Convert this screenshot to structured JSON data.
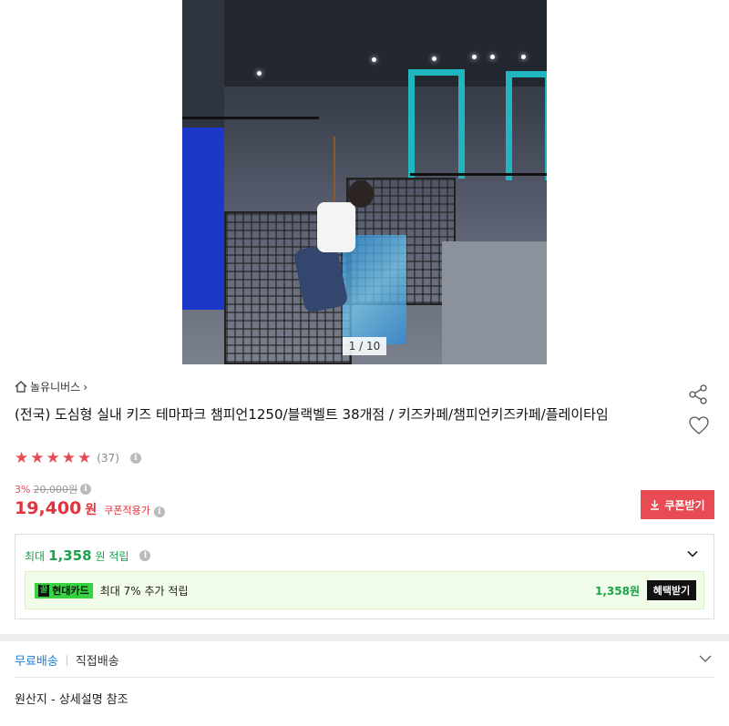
{
  "gallery": {
    "counter": "1 / 10"
  },
  "brand": {
    "name": "놀유니버스",
    "home_icon": "home-icon",
    "arrow": "›"
  },
  "product": {
    "title": "(전국) 도심형 실내 키즈 테마파크 챔피언1250/블랙벨트 38개점 / 키즈카페/챔피언키즈카페/플레이타임",
    "rating": {
      "stars": 5,
      "count": "(37)"
    }
  },
  "price": {
    "discount_pct": "3%",
    "original": "20,000원",
    "current": "19,400",
    "currency": "원",
    "coupon_price_label": "쿠폰적용가"
  },
  "coupon_button": {
    "label": "쿠폰받기"
  },
  "reward": {
    "prefix": "최대",
    "amount": "1,358",
    "suffix": "원 적립",
    "card": {
      "logo_text": "현대카드",
      "logo_mark": "꿀",
      "description": "최대 7% 추가 적립",
      "amount": "1,358원",
      "button": "혜택받기"
    }
  },
  "shipping": {
    "free": "무료배송",
    "direct": "직접배송"
  },
  "origin": "원산지 - 상세설명 참조",
  "colors": {
    "accent_red": "#e94b55",
    "price_red": "#e4323d",
    "reward_green": "#1aa34a",
    "shipping_blue": "#1e7fd9"
  }
}
